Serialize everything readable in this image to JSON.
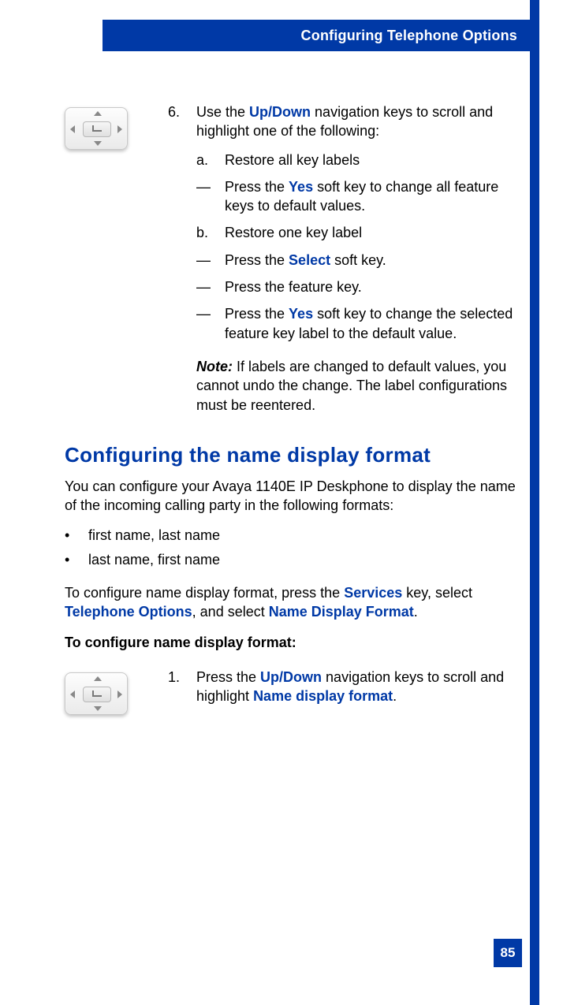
{
  "header": {
    "title": "Configuring Telephone Options"
  },
  "step6": {
    "num": "6.",
    "intro_before": "Use the ",
    "intro_link": "Up/Down",
    "intro_after": " navigation keys to scroll and highlight one of the following:",
    "a_mark": "a.",
    "a_text": "Restore all key labels",
    "a_sub1_before": "Press the ",
    "a_sub1_link": "Yes",
    "a_sub1_after": " soft key to change all feature keys to default values.",
    "b_mark": "b.",
    "b_text": "Restore one key label",
    "b_sub1_before": "Press the ",
    "b_sub1_link": "Select",
    "b_sub1_after": " soft key.",
    "b_sub2": "Press the feature key.",
    "b_sub3_before": "Press the ",
    "b_sub3_link": "Yes",
    "b_sub3_after": " soft key to change the selected feature key label to the default value.",
    "note_label": "Note:",
    "note_text": " If labels are changed to default values, you cannot undo the change. The label configurations must be reentered."
  },
  "section": {
    "heading": "Configuring the name display format",
    "p1": "You can configure your Avaya 1140E IP Deskphone to display the name of the incoming calling party in the following formats:",
    "bullet1": "first name, last name",
    "bullet2": "last name, first name",
    "p2_a": "To configure name display format, press the ",
    "p2_link1": "Services",
    "p2_b": " key, select ",
    "p2_link2": "Telephone Options",
    "p2_c": ", and select ",
    "p2_link3": "Name Display Format",
    "p2_d": ".",
    "subhead": "To configure name display format:"
  },
  "step1": {
    "num": "1.",
    "before": "Press the ",
    "link1": "Up/Down",
    "mid": " navigation keys to scroll and highlight ",
    "link2": "Name display format",
    "after": "."
  },
  "dash": "—",
  "bullet_mark": "•",
  "page_number": "85"
}
